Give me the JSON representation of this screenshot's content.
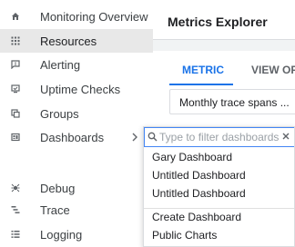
{
  "sidebar": {
    "items": [
      {
        "label": "Monitoring Overview",
        "icon": "home-icon",
        "active": false
      },
      {
        "label": "Resources",
        "icon": "grid-icon",
        "active": true
      },
      {
        "label": "Alerting",
        "icon": "alert-chat-icon",
        "active": false
      },
      {
        "label": "Uptime Checks",
        "icon": "monitor-icon",
        "active": false
      },
      {
        "label": "Groups",
        "icon": "groups-icon",
        "active": false
      },
      {
        "label": "Dashboards",
        "icon": "dashboard-icon",
        "active": false
      },
      {
        "label": "Debug",
        "icon": "debug-icon",
        "active": false
      },
      {
        "label": "Trace",
        "icon": "trace-icon",
        "active": false
      },
      {
        "label": "Logging",
        "icon": "logging-icon",
        "active": false
      }
    ]
  },
  "main": {
    "title": "Metrics Explorer",
    "tabs": [
      {
        "label": "METRIC",
        "selected": true
      },
      {
        "label": "VIEW OP",
        "selected": false
      }
    ],
    "metric_field_value": "Monthly trace spans ..."
  },
  "dropdown": {
    "filter_placeholder": "Type to filter dashboards",
    "dashboards": [
      "Gary Dashboard",
      "Untitled Dashboard",
      "Untitled Dashboard"
    ],
    "actions": [
      "Create Dashboard",
      "Public Charts"
    ]
  },
  "colors": {
    "accent": "#1a73e8",
    "active_bg": "#e8e8e8",
    "focus_border": "#4285f4"
  }
}
